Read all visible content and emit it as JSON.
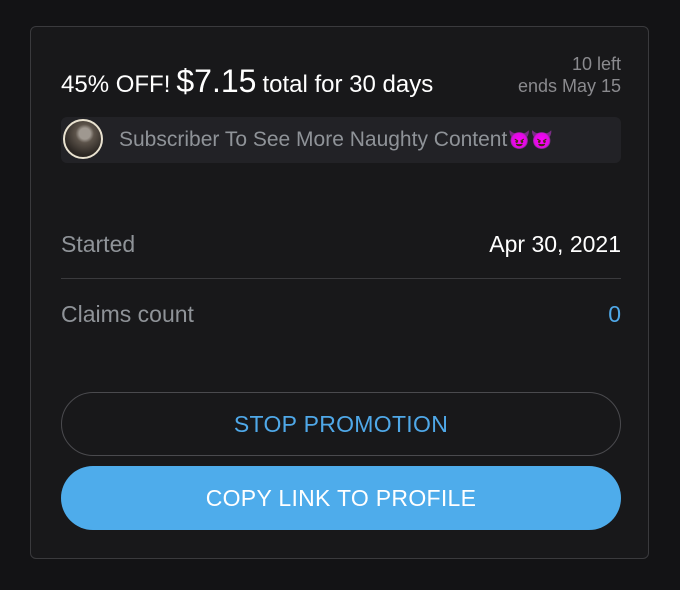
{
  "promotion": {
    "discount_label": "45% OFF!",
    "price": "$7.15",
    "duration_label": "total for 30 days",
    "remaining": "10 left",
    "ends": "ends May 15"
  },
  "message": {
    "text": "Subscriber To See More Naughty Content",
    "emojis": "😈😈"
  },
  "details": {
    "started_label": "Started",
    "started_value": "Apr 30, 2021",
    "claims_label": "Claims count",
    "claims_value": "0"
  },
  "actions": {
    "stop_label": "STOP PROMOTION",
    "copy_label": "COPY LINK TO PROFILE"
  },
  "colors": {
    "accent": "#4eaceb",
    "background": "#131315",
    "muted_text": "#8f9398"
  }
}
